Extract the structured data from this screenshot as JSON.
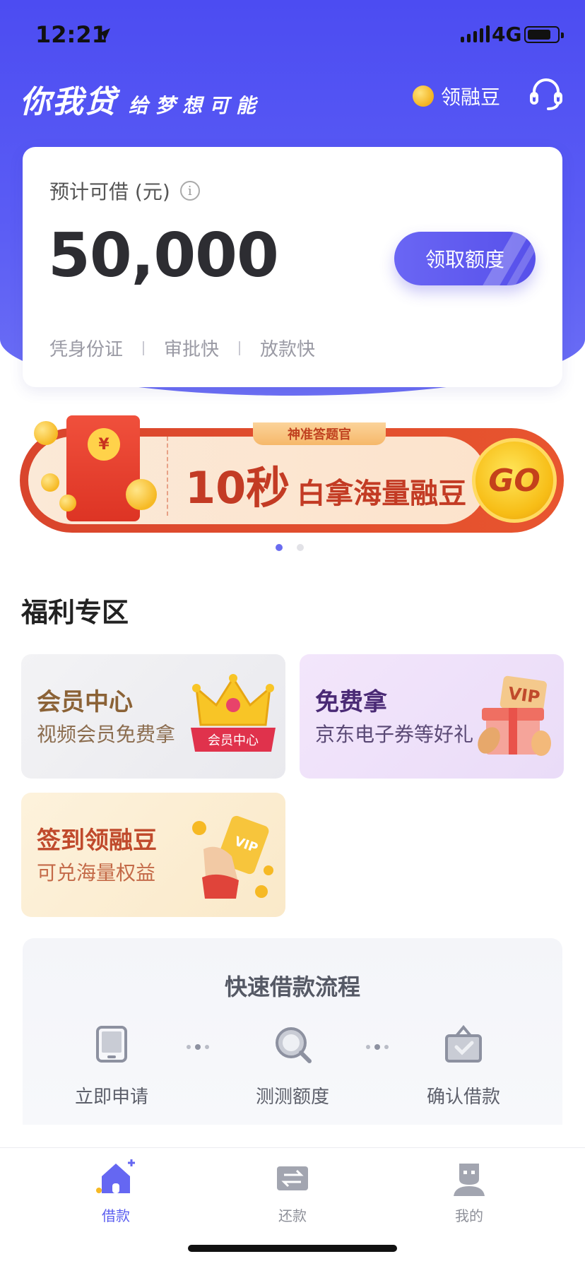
{
  "status_bar": {
    "time": "12:21",
    "network": "4G"
  },
  "header": {
    "brand_name": "你我贷",
    "slogan": "给梦想可能",
    "coin_link": "领融豆",
    "support_icon": "headset-icon",
    "coin_icon": "coin-icon"
  },
  "loan_card": {
    "label": "预计可借 (元)",
    "amount": "50,000",
    "claim_button": "领取额度",
    "features": [
      "凭身份证",
      "审批快",
      "放款快"
    ]
  },
  "banner": {
    "tag": "神准答题官",
    "big_text": "10秒",
    "small_text": "白拿海量融豆",
    "go_label": "GO",
    "envelope_symbol": "¥",
    "page_count": 2,
    "active_page": 1
  },
  "welfare": {
    "title": "福利专区",
    "cards": [
      {
        "title": "会员中心",
        "subtitle": "视频会员免费拿",
        "badge": "会员中心"
      },
      {
        "title": "免费拿",
        "subtitle": "京东电子券等好礼",
        "badge": "VIP"
      },
      {
        "title": "签到领融豆",
        "subtitle": "可兑海量权益",
        "badge": "VIP"
      }
    ]
  },
  "flow": {
    "title": "快速借款流程",
    "steps": [
      {
        "label": "立即申请",
        "icon": "tablet-icon"
      },
      {
        "label": "测测额度",
        "icon": "magnifier-icon"
      },
      {
        "label": "确认借款",
        "icon": "briefcase-check-icon"
      }
    ]
  },
  "tabbar": {
    "tabs": [
      {
        "label": "借款",
        "icon": "home-icon",
        "active": true
      },
      {
        "label": "还款",
        "icon": "repay-icon",
        "active": false
      },
      {
        "label": "我的",
        "icon": "profile-icon",
        "active": false
      }
    ]
  },
  "colors": {
    "brand": "#4c4cf2",
    "accent": "#5b5ef0",
    "banner_red": "#d9452c",
    "go_yellow": "#f7bd16"
  }
}
